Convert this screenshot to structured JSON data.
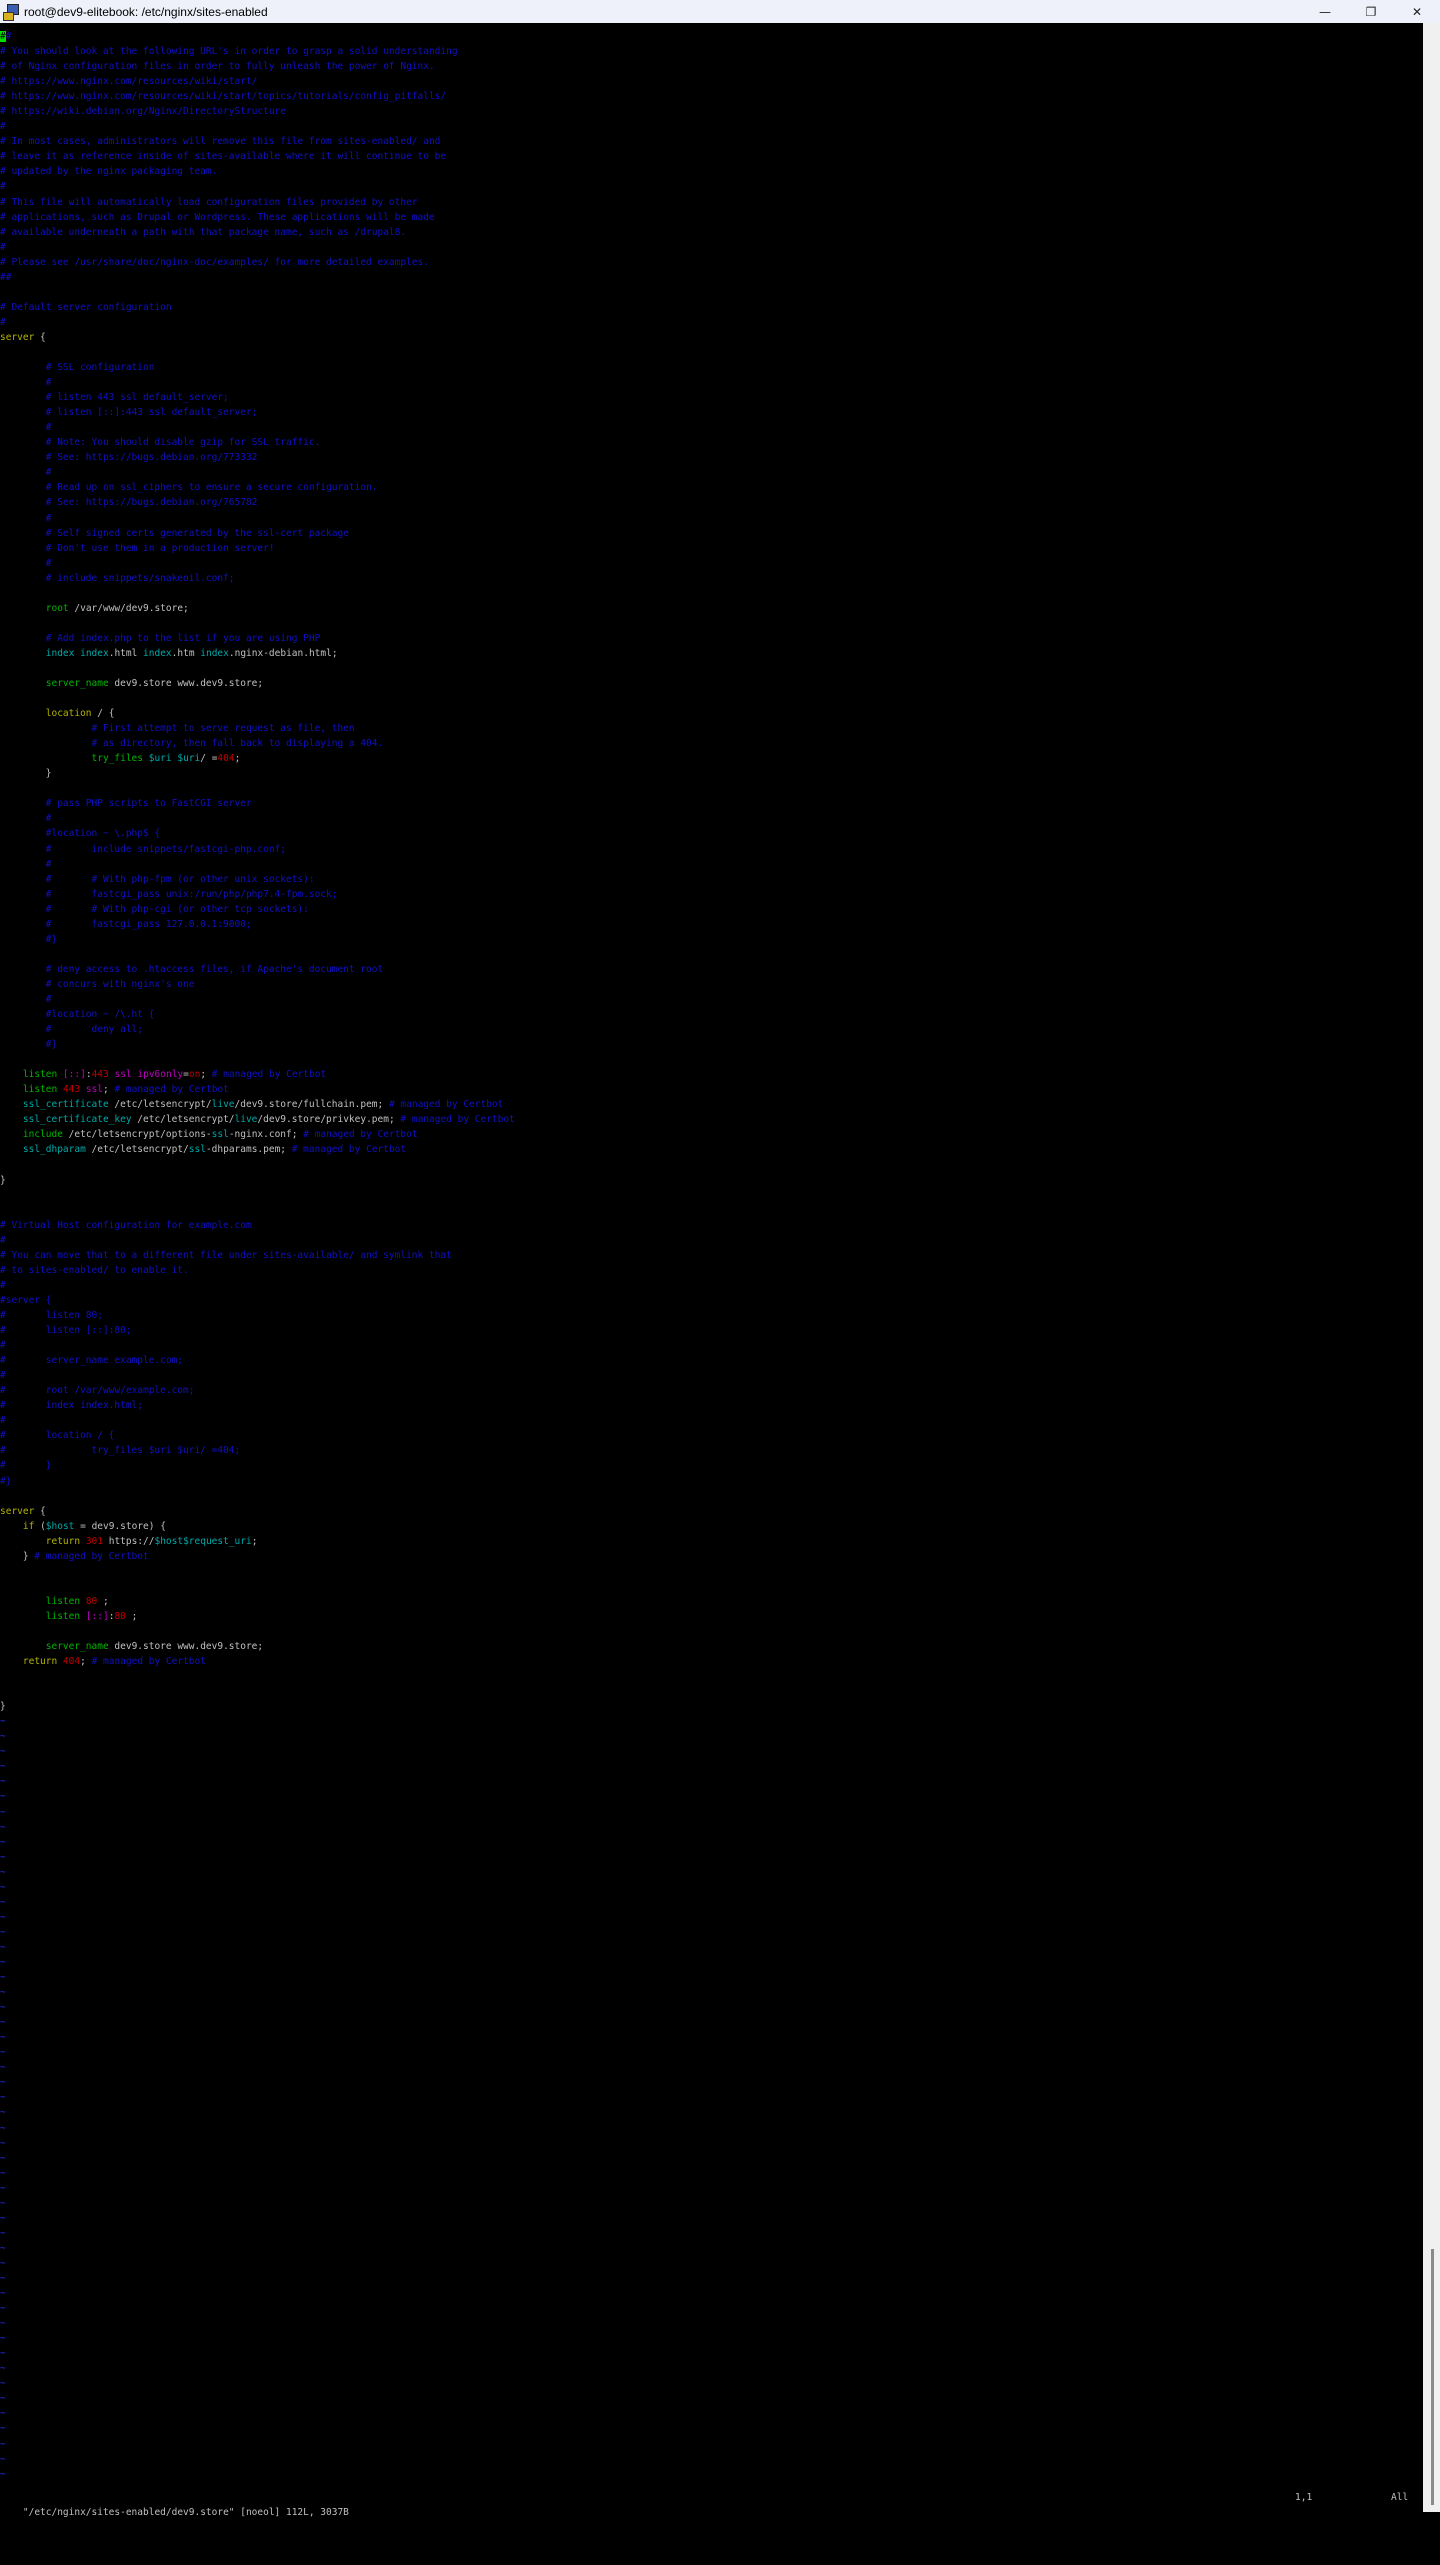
{
  "window": {
    "title": "root@dev9-elitebook: /etc/nginx/sites-enabled",
    "minimize": "—",
    "restore": "❐",
    "close": "✕"
  },
  "colors": {
    "comment": "#1010c4",
    "keyword": "#b4b400",
    "directive": "#00b400",
    "variable": "#00a8a8",
    "number": "#c00000",
    "special": "#c000c0",
    "text": "#c0c0c0",
    "cursor": "#00e000",
    "tilde": "#2a2aff"
  },
  "editor": {
    "lines": [
      [
        [
          "#",
          "cur"
        ],
        [
          "#",
          "c"
        ]
      ],
      [
        [
          "# You should look at the following URL's in order to grasp a solid understanding",
          "c"
        ]
      ],
      [
        [
          "# of Nginx configuration files in order to fully unleash the power of Nginx.",
          "c"
        ]
      ],
      [
        [
          "# https://www.nginx.com/resources/wiki/start/",
          "c"
        ]
      ],
      [
        [
          "# https://www.nginx.com/resources/wiki/start/topics/tutorials/config_pitfalls/",
          "c"
        ]
      ],
      [
        [
          "# https://wiki.debian.org/Nginx/DirectoryStructure",
          "c"
        ]
      ],
      [
        [
          "#",
          "c"
        ]
      ],
      [
        [
          "# In most cases, administrators will remove this file from sites-enabled/ and",
          "c"
        ]
      ],
      [
        [
          "# leave it as reference inside of sites-available where it will continue to be",
          "c"
        ]
      ],
      [
        [
          "# updated by the nginx packaging team.",
          "c"
        ]
      ],
      [
        [
          "#",
          "c"
        ]
      ],
      [
        [
          "# This file will automatically load configuration files provided by other",
          "c"
        ]
      ],
      [
        [
          "# applications, such as Drupal or Wordpress. These applications will be made",
          "c"
        ]
      ],
      [
        [
          "# available underneath a path with that package name, such as /drupal8.",
          "c"
        ]
      ],
      [
        [
          "#",
          "c"
        ]
      ],
      [
        [
          "# Please see /usr/share/doc/nginx-doc/examples/ for more detailed examples.",
          "c"
        ]
      ],
      [
        [
          "##",
          "c"
        ]
      ],
      [],
      [
        [
          "# Default server configuration",
          "c"
        ]
      ],
      [
        [
          "#",
          "c"
        ]
      ],
      [
        [
          "server",
          "k"
        ],
        [
          " {",
          "d"
        ]
      ],
      [],
      [
        [
          "        # SSL configuration",
          "c"
        ]
      ],
      [
        [
          "        #",
          "c"
        ]
      ],
      [
        [
          "        # listen 443 ssl default_server;",
          "c"
        ]
      ],
      [
        [
          "        # listen [::]:443 ssl default_server;",
          "c"
        ]
      ],
      [
        [
          "        #",
          "c"
        ]
      ],
      [
        [
          "        # Note: You should disable gzip for SSL traffic.",
          "c"
        ]
      ],
      [
        [
          "        # See: https://bugs.debian.org/773332",
          "c"
        ]
      ],
      [
        [
          "        #",
          "c"
        ]
      ],
      [
        [
          "        # Read up on ssl_ciphers to ensure a secure configuration.",
          "c"
        ]
      ],
      [
        [
          "        # See: https://bugs.debian.org/765782",
          "c"
        ]
      ],
      [
        [
          "        #",
          "c"
        ]
      ],
      [
        [
          "        # Self signed certs generated by the ssl-cert package",
          "c"
        ]
      ],
      [
        [
          "        # Don't use them in a production server!",
          "c"
        ]
      ],
      [
        [
          "        #",
          "c"
        ]
      ],
      [
        [
          "        # include snippets/snakeoil.conf;",
          "c"
        ]
      ],
      [],
      [
        [
          "        ",
          "d"
        ],
        [
          "root",
          "g"
        ],
        [
          " /var/www/dev9.store;",
          "d"
        ]
      ],
      [],
      [
        [
          "        # Add index.php to the list if you are using PHP",
          "c"
        ]
      ],
      [
        [
          "        ",
          "d"
        ],
        [
          "index",
          "t"
        ],
        [
          " ",
          "d"
        ],
        [
          "index",
          "t"
        ],
        [
          ".html ",
          "d"
        ],
        [
          "index",
          "t"
        ],
        [
          ".htm ",
          "d"
        ],
        [
          "index",
          "t"
        ],
        [
          ".nginx-debian.html;",
          "d"
        ]
      ],
      [],
      [
        [
          "        ",
          "d"
        ],
        [
          "server_name",
          "g"
        ],
        [
          " dev9.store www.dev9.store;",
          "d"
        ]
      ],
      [],
      [
        [
          "        ",
          "d"
        ],
        [
          "location",
          "k"
        ],
        [
          " / {",
          "d"
        ]
      ],
      [
        [
          "                # First attempt to serve request as file, then",
          "c"
        ]
      ],
      [
        [
          "                # as directory, then fall back to displaying a 404.",
          "c"
        ]
      ],
      [
        [
          "                ",
          "d"
        ],
        [
          "try_files",
          "g"
        ],
        [
          " ",
          "d"
        ],
        [
          "$uri",
          "t"
        ],
        [
          " ",
          "d"
        ],
        [
          "$uri",
          "t"
        ],
        [
          "/ =",
          "d"
        ],
        [
          "404",
          "n"
        ],
        [
          ";",
          "d"
        ]
      ],
      [
        [
          "        }",
          "d"
        ]
      ],
      [],
      [
        [
          "        # pass PHP scripts to FastCGI server",
          "c"
        ]
      ],
      [
        [
          "        #",
          "c"
        ]
      ],
      [
        [
          "        #location ~ \\.php$ {",
          "c"
        ]
      ],
      [
        [
          "        #       include snippets/fastcgi-php.conf;",
          "c"
        ]
      ],
      [
        [
          "        #",
          "c"
        ]
      ],
      [
        [
          "        #       # With php-fpm (or other unix sockets):",
          "c"
        ]
      ],
      [
        [
          "        #       fastcgi_pass unix:/run/php/php7.4-fpm.sock;",
          "c"
        ]
      ],
      [
        [
          "        #       # With php-cgi (or other tcp sockets):",
          "c"
        ]
      ],
      [
        [
          "        #       fastcgi_pass 127.0.0.1:9000;",
          "c"
        ]
      ],
      [
        [
          "        #}",
          "c"
        ]
      ],
      [],
      [
        [
          "        # deny access to .htaccess files, if Apache's document root",
          "c"
        ]
      ],
      [
        [
          "        # concurs with nginx's one",
          "c"
        ]
      ],
      [
        [
          "        #",
          "c"
        ]
      ],
      [
        [
          "        #location ~ /\\.ht {",
          "c"
        ]
      ],
      [
        [
          "        #       deny all;",
          "c"
        ]
      ],
      [
        [
          "        #}",
          "c"
        ]
      ],
      [],
      [
        [
          "    ",
          "d"
        ],
        [
          "listen",
          "g"
        ],
        [
          " ",
          "d"
        ],
        [
          "[::]",
          "m"
        ],
        [
          ":",
          "d"
        ],
        [
          "443",
          "n"
        ],
        [
          " ",
          "d"
        ],
        [
          "ssl",
          "m"
        ],
        [
          " ",
          "d"
        ],
        [
          "ipv6only",
          "m"
        ],
        [
          "=",
          "d"
        ],
        [
          "on",
          "n"
        ],
        [
          "; ",
          "d"
        ],
        [
          "# managed by Certbot",
          "c"
        ]
      ],
      [
        [
          "    ",
          "d"
        ],
        [
          "listen",
          "g"
        ],
        [
          " ",
          "d"
        ],
        [
          "443",
          "n"
        ],
        [
          " ",
          "d"
        ],
        [
          "ssl",
          "m"
        ],
        [
          "; ",
          "d"
        ],
        [
          "# managed by Certbot",
          "c"
        ]
      ],
      [
        [
          "    ",
          "d"
        ],
        [
          "ssl_certificate",
          "t"
        ],
        [
          " /etc/letsencrypt/",
          "d"
        ],
        [
          "live",
          "t"
        ],
        [
          "/dev9.store/fullchain.pem; ",
          "d"
        ],
        [
          "# managed by Certbot",
          "c"
        ]
      ],
      [
        [
          "    ",
          "d"
        ],
        [
          "ssl_certificate_key",
          "t"
        ],
        [
          " /etc/letsencrypt/",
          "d"
        ],
        [
          "live",
          "t"
        ],
        [
          "/dev9.store/privkey.pem; ",
          "d"
        ],
        [
          "# managed by Certbot",
          "c"
        ]
      ],
      [
        [
          "    ",
          "d"
        ],
        [
          "include",
          "g"
        ],
        [
          " /etc/letsencrypt/options-",
          "d"
        ],
        [
          "ssl",
          "t"
        ],
        [
          "-nginx.conf; ",
          "d"
        ],
        [
          "# managed by Certbot",
          "c"
        ]
      ],
      [
        [
          "    ",
          "d"
        ],
        [
          "ssl_dhparam",
          "t"
        ],
        [
          " /etc/letsencrypt/",
          "d"
        ],
        [
          "ssl",
          "t"
        ],
        [
          "-dhparams.pem; ",
          "d"
        ],
        [
          "# managed by Certbot",
          "c"
        ]
      ],
      [],
      [
        [
          "}",
          "d"
        ]
      ],
      [],
      [],
      [
        [
          "# Virtual Host configuration for example.com",
          "c"
        ]
      ],
      [
        [
          "#",
          "c"
        ]
      ],
      [
        [
          "# You can move that to a different file under sites-available/ and symlink that",
          "c"
        ]
      ],
      [
        [
          "# to sites-enabled/ to enable it.",
          "c"
        ]
      ],
      [
        [
          "#",
          "c"
        ]
      ],
      [
        [
          "#server {",
          "c"
        ]
      ],
      [
        [
          "#       listen 80;",
          "c"
        ]
      ],
      [
        [
          "#       listen [::]:80;",
          "c"
        ]
      ],
      [
        [
          "#",
          "c"
        ]
      ],
      [
        [
          "#       server_name example.com;",
          "c"
        ]
      ],
      [
        [
          "#",
          "c"
        ]
      ],
      [
        [
          "#       root /var/www/example.com;",
          "c"
        ]
      ],
      [
        [
          "#       index index.html;",
          "c"
        ]
      ],
      [
        [
          "#",
          "c"
        ]
      ],
      [
        [
          "#       location / {",
          "c"
        ]
      ],
      [
        [
          "#               try_files $uri $uri/ =404;",
          "c"
        ]
      ],
      [
        [
          "#       }",
          "c"
        ]
      ],
      [
        [
          "#}",
          "c"
        ]
      ],
      [],
      [
        [
          "server",
          "k"
        ],
        [
          " {",
          "d"
        ]
      ],
      [
        [
          "    ",
          "d"
        ],
        [
          "if",
          "k"
        ],
        [
          " (",
          "d"
        ],
        [
          "$host",
          "t"
        ],
        [
          " = dev9.store) {",
          "d"
        ]
      ],
      [
        [
          "        ",
          "d"
        ],
        [
          "return",
          "k"
        ],
        [
          " ",
          "d"
        ],
        [
          "301",
          "n"
        ],
        [
          " https://",
          "d"
        ],
        [
          "$host$request_uri",
          "t"
        ],
        [
          ";",
          "d"
        ]
      ],
      [
        [
          "    } ",
          "d"
        ],
        [
          "# managed by Certbot",
          "c"
        ]
      ],
      [],
      [],
      [
        [
          "        ",
          "d"
        ],
        [
          "listen",
          "g"
        ],
        [
          " ",
          "d"
        ],
        [
          "80",
          "n"
        ],
        [
          " ;",
          "d"
        ]
      ],
      [
        [
          "        ",
          "d"
        ],
        [
          "listen",
          "g"
        ],
        [
          " ",
          "d"
        ],
        [
          "[::]",
          "m"
        ],
        [
          ":",
          "d"
        ],
        [
          "80",
          "n"
        ],
        [
          " ;",
          "d"
        ]
      ],
      [],
      [
        [
          "        ",
          "d"
        ],
        [
          "server_name",
          "g"
        ],
        [
          " dev9.store www.dev9.store;",
          "d"
        ]
      ],
      [
        [
          "    ",
          "d"
        ],
        [
          "return",
          "k"
        ],
        [
          " ",
          "d"
        ],
        [
          "404",
          "n"
        ],
        [
          "; ",
          "d"
        ],
        [
          "# managed by Certbot",
          "c"
        ]
      ],
      [],
      [],
      [
        [
          "}",
          "d"
        ]
      ]
    ],
    "empty_line_marker": "~"
  },
  "status": {
    "message": "\"/etc/nginx/sites-enabled/dev9.store\" [noeol] 112L, 3037B",
    "position": "1,1",
    "scroll": "All"
  }
}
